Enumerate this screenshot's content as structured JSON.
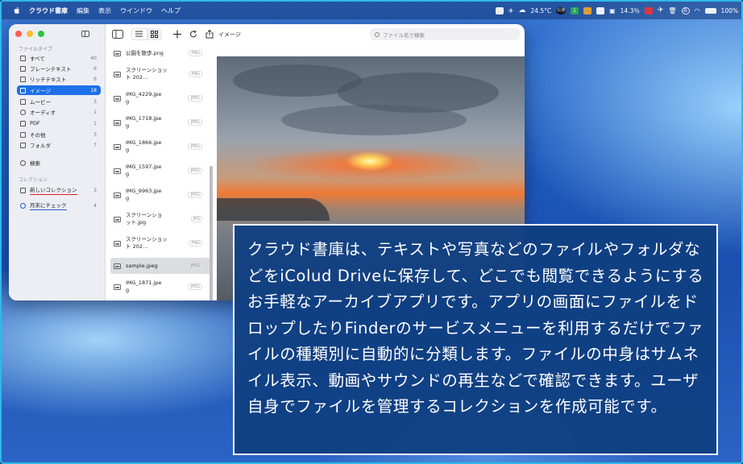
{
  "menubar": {
    "app_name": "クラウド書庫",
    "menus": [
      "編集",
      "表示",
      "ウインドウ",
      "ヘルプ"
    ],
    "status": {
      "temperature": "24.5°C",
      "battery_pct": "14.3％",
      "input_mode": "あ",
      "wifi_battery": "100%",
      "calendar_badge": "1",
      "clock_icon_label": "公演"
    }
  },
  "sidebar": {
    "section_filetype": "ファイルタイプ",
    "items": [
      {
        "label": "すべて",
        "count": "40",
        "icon": "stack-icon"
      },
      {
        "label": "プレーンテキスト",
        "count": "6",
        "icon": "doc-icon"
      },
      {
        "label": "リッチテキスト",
        "count": "6",
        "icon": "richtext-icon"
      },
      {
        "label": "イメージ",
        "count": "18",
        "icon": "image-icon"
      },
      {
        "label": "ムービー",
        "count": "3",
        "icon": "movie-icon"
      },
      {
        "label": "オーディオ",
        "count": "1",
        "icon": "music-icon"
      },
      {
        "label": "PDF",
        "count": "1",
        "icon": "pdf-icon"
      },
      {
        "label": "その他",
        "count": "3",
        "icon": "other-icon"
      },
      {
        "label": "フォルダ",
        "count": "7",
        "icon": "folder-icon"
      }
    ],
    "search_label": "検索",
    "section_collection": "コレクション",
    "collections": [
      {
        "label": "新しいコレクション",
        "count": "3"
      },
      {
        "label": "月末にチェック",
        "count": "4"
      }
    ]
  },
  "toolbar": {
    "title": "イメージ",
    "search_placeholder": "ファイル名で検索"
  },
  "files": [
    {
      "name": "公園を散歩.png",
      "type": "PNG"
    },
    {
      "name": "スクリーンショット 202…",
      "type": "PNG"
    },
    {
      "name": "IMG_4229.jpeg",
      "type": "JPEG"
    },
    {
      "name": "IMG_1718.jpeg",
      "type": "JPEG"
    },
    {
      "name": "IMG_1866.jpeg",
      "type": "JPEG"
    },
    {
      "name": "IMG_1597.jpeg",
      "type": "JPEG"
    },
    {
      "name": "IMG_9963.jpeg",
      "type": "JPEG"
    },
    {
      "name": "スクリーンショット.jpg",
      "type": "JPG"
    },
    {
      "name": "スクリーンショット 202…",
      "type": "PNG"
    },
    {
      "name": "sample.jpeg",
      "type": "JPEG"
    },
    {
      "name": "IMG_1871.jpeg",
      "type": "JPEG"
    }
  ],
  "caption": "クラウド書庫は、テキストや写真などのファイルやフォルダなどをiColud Driveに保存して、どこでも閲覧できるようにするお手軽なアーカイブアプリです。アプリの画面にファイルをドロップしたりFinderのサービスメニューを利用するだけでファイルの種類別に自動的に分類します。ファイルの中身はサムネイル表示、動画やサウンドの再生などで確認できます。ユーザ自身でファイルを管理するコレクションを作成可能です。"
}
